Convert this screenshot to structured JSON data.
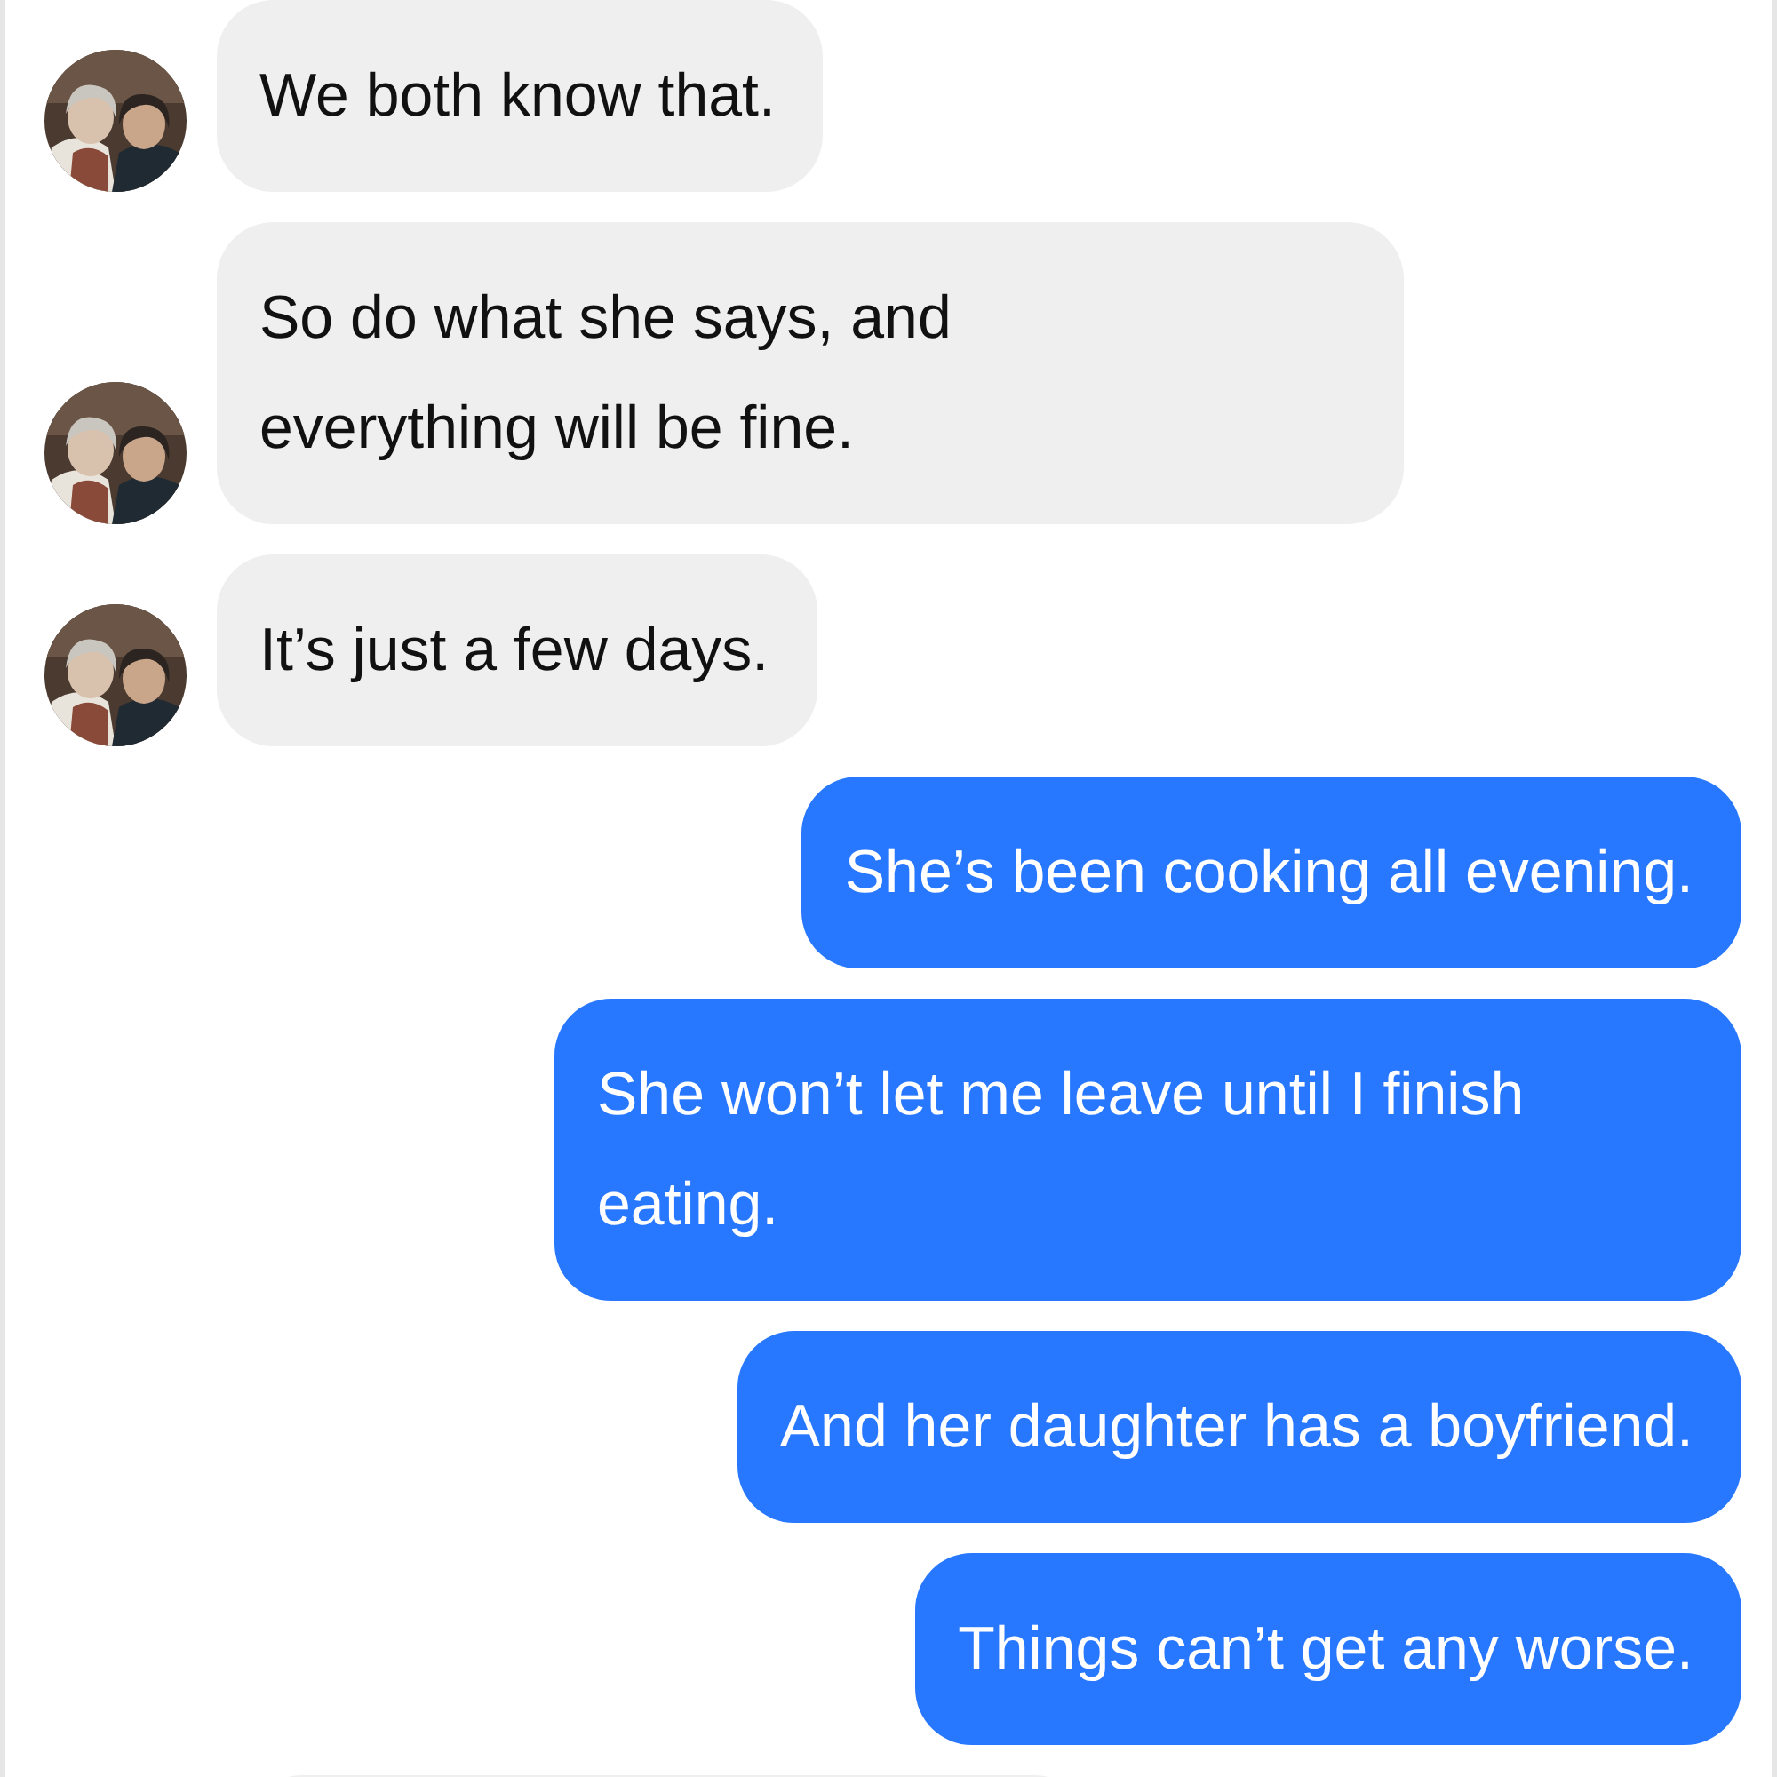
{
  "messages": [
    {
      "kind": "received",
      "lines": [
        "We both know that."
      ]
    },
    {
      "kind": "received",
      "lines": [
        "So do what she says, and",
        "everything will be fine."
      ]
    },
    {
      "kind": "received",
      "lines": [
        "It’s just a few days."
      ]
    },
    {
      "kind": "sent",
      "lines": [
        "She’s been cooking all evening."
      ]
    },
    {
      "kind": "sent",
      "lines": [
        "She won’t let me leave until I finish",
        "eating."
      ]
    },
    {
      "kind": "sent",
      "lines": [
        "And her daughter has a boyfriend."
      ]
    },
    {
      "kind": "sent",
      "lines": [
        "Things can’t get any worse."
      ]
    }
  ]
}
